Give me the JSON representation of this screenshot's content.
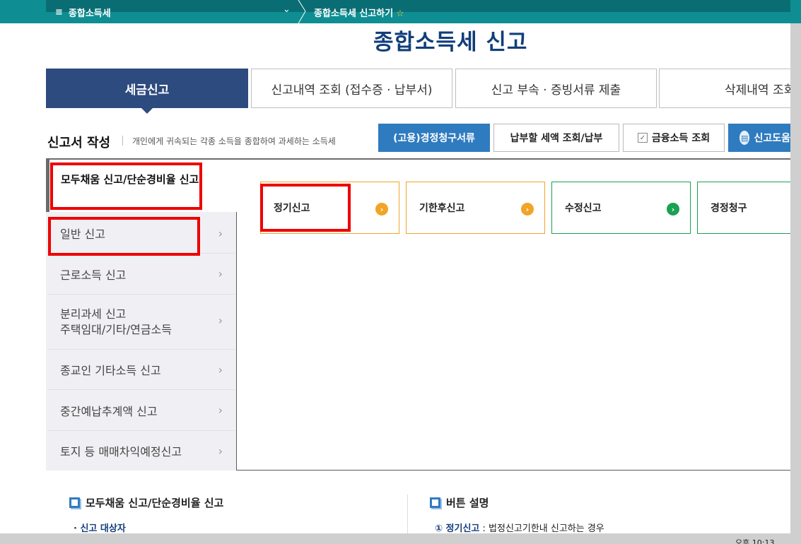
{
  "topbar": {
    "menu_icon": "≡",
    "menu_label": "종합소득세",
    "dropdown_icon": "⌄",
    "breadcrumb": "종합소득세 신고하기",
    "star_icon": "☆"
  },
  "page_title": "종합소득세 신고",
  "tabs": [
    {
      "label": "세금신고"
    },
    {
      "label": "신고내역 조회 (접수증 · 납부서)"
    },
    {
      "label": "신고 부속 · 증빙서류 제출"
    },
    {
      "label": "삭제내역 조회"
    }
  ],
  "section": {
    "title": "신고서 작성",
    "description": "개인에게 귀속되는 각종 소득을 종합하여 과세하는 소득세"
  },
  "buttons": {
    "correction_docs": "(고용)경정청구서류",
    "tax_payment": "납부할 세액 조회/납부",
    "financial_income": "금융소득 조회",
    "filing_help": "신고도움"
  },
  "menu": {
    "selected": "모두채움 신고/단순경비율 신고",
    "items": [
      {
        "label": "일반 신고"
      },
      {
        "label": "근로소득 신고"
      },
      {
        "label": "분리과세 신고",
        "label2": "주택임대/기타/연금소득"
      },
      {
        "label": "종교인 기타소득 신고"
      },
      {
        "label": "중간예납추계액 신고"
      },
      {
        "label": "토지 등 매매차익예정신고"
      }
    ],
    "chevron": "›"
  },
  "cards": [
    {
      "label": "정기신고",
      "icon": "›",
      "color": "#f0a527"
    },
    {
      "label": "기한후신고",
      "icon": "›",
      "color": "#f0a527"
    },
    {
      "label": "수정신고",
      "icon": "›",
      "color": "#1aa152"
    },
    {
      "label": "경정청구",
      "icon": "›",
      "color": "#1aa152"
    }
  ],
  "info": {
    "left_title": "모두채움 신고/단순경비율 신고",
    "left_sub": "· 신고 대상자",
    "right_title": "버튼 설명",
    "right_line_label": "① 정기신고",
    "right_line_text": " : 법정신고기한내 신고하는 경우"
  },
  "clock": "오후 10:13"
}
